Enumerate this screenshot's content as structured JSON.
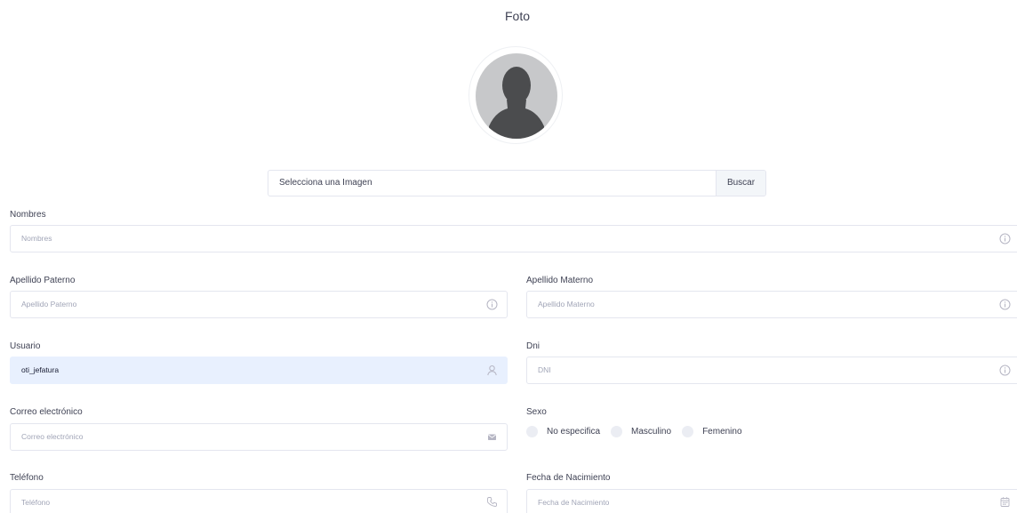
{
  "photo": {
    "title": "Foto"
  },
  "file": {
    "placeholder": "Selecciona una Imagen",
    "button": "Buscar"
  },
  "fields": {
    "nombres": {
      "label": "Nombres",
      "placeholder": "Nombres",
      "icon": "info-icon"
    },
    "apellido_paterno": {
      "label": "Apellido Paterno",
      "placeholder": "Apellido Paterno",
      "icon": "info-icon"
    },
    "apellido_materno": {
      "label": "Apellido Materno",
      "placeholder": "Apellido Materno",
      "icon": "info-icon"
    },
    "usuario": {
      "label": "Usuario",
      "value": "oti_jefatura",
      "icon": "user-icon"
    },
    "dni": {
      "label": "Dni",
      "placeholder": "DNI",
      "icon": "info-icon"
    },
    "correo": {
      "label": "Correo electrónico",
      "placeholder": "Correo electrónico",
      "icon": "envelope-icon"
    },
    "sexo": {
      "label": "Sexo",
      "options": [
        "No especifica",
        "Masculino",
        "Femenino"
      ]
    },
    "telefono": {
      "label": "Teléfono",
      "placeholder": "Teléfono",
      "icon": "phone-icon"
    },
    "fecha_nacimiento": {
      "label": "Fecha de Nacimiento",
      "placeholder": "Fecha de Nacimiento",
      "icon": "calendar-icon"
    }
  },
  "colors": {
    "input_border": "#e4e6ef",
    "autofill_bg": "#e8f0fe",
    "avatar_bg": "#c7c8ca",
    "avatar_fg": "#4b4c4e"
  }
}
